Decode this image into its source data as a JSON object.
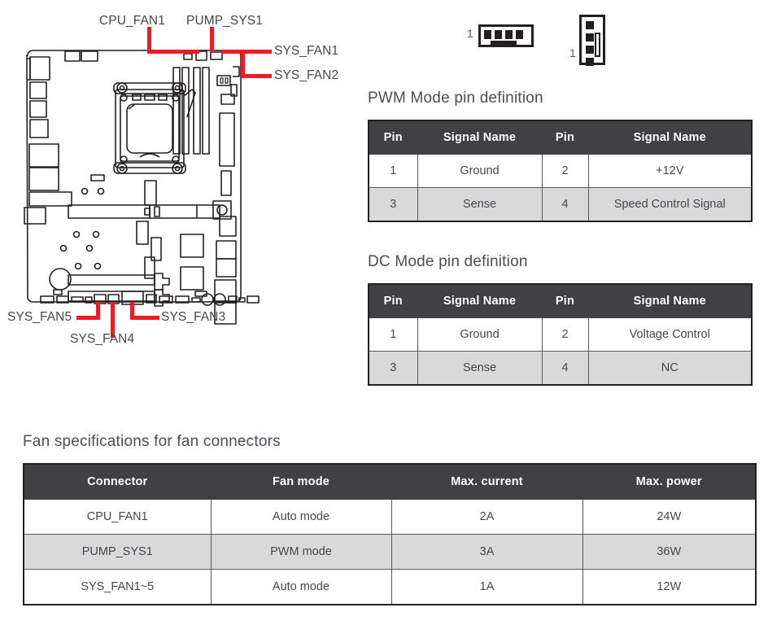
{
  "board_diagram": {
    "name": "motherboard-layout",
    "callouts": [
      {
        "id": "cpu-fan1",
        "label": "CPU_FAN1"
      },
      {
        "id": "pump-sys1",
        "label": "PUMP_SYS1"
      },
      {
        "id": "sys-fan1",
        "label": "SYS_FAN1"
      },
      {
        "id": "sys-fan2",
        "label": "SYS_FAN2"
      },
      {
        "id": "sys-fan5",
        "label": "SYS_FAN5"
      },
      {
        "id": "sys-fan4",
        "label": "SYS_FAN4"
      },
      {
        "id": "sys-fan3",
        "label": "SYS_FAN3"
      }
    ],
    "leader_color": "#ed1c24"
  },
  "connectors": {
    "horizontal_header": {
      "pin_one_label": "1",
      "pin_count": 4
    },
    "vertical_header": {
      "pin_one_label": "1",
      "pin_count": 4
    }
  },
  "pwm_table": {
    "title": "PWM Mode pin definition",
    "headers": [
      "Pin",
      "Signal Name",
      "Pin",
      "Signal Name"
    ],
    "rows": [
      [
        "1",
        "Ground",
        "2",
        "+12V"
      ],
      [
        "3",
        "Sense",
        "4",
        "Speed Control Signal"
      ]
    ]
  },
  "dc_table": {
    "title": "DC Mode pin definition",
    "headers": [
      "Pin",
      "Signal Name",
      "Pin",
      "Signal Name"
    ],
    "rows": [
      [
        "1",
        "Ground",
        "2",
        "Voltage Control"
      ],
      [
        "3",
        "Sense",
        "4",
        "NC"
      ]
    ]
  },
  "fan_table": {
    "title": "Fan specifications for fan connectors",
    "headers": [
      "Connector",
      "Fan mode",
      "Max. current",
      "Max. power"
    ],
    "rows": [
      [
        "CPU_FAN1",
        "Auto mode",
        "2A",
        "24W"
      ],
      [
        "PUMP_SYS1",
        "PWM mode",
        "3A",
        "36W"
      ],
      [
        "SYS_FAN1~5",
        "Auto mode",
        "1A",
        "12W"
      ]
    ]
  },
  "colors": {
    "header_bg": "#414042",
    "alt_row_bg": "#d9d9d9",
    "accent_red": "#ed1c24",
    "text": "#44474d"
  }
}
